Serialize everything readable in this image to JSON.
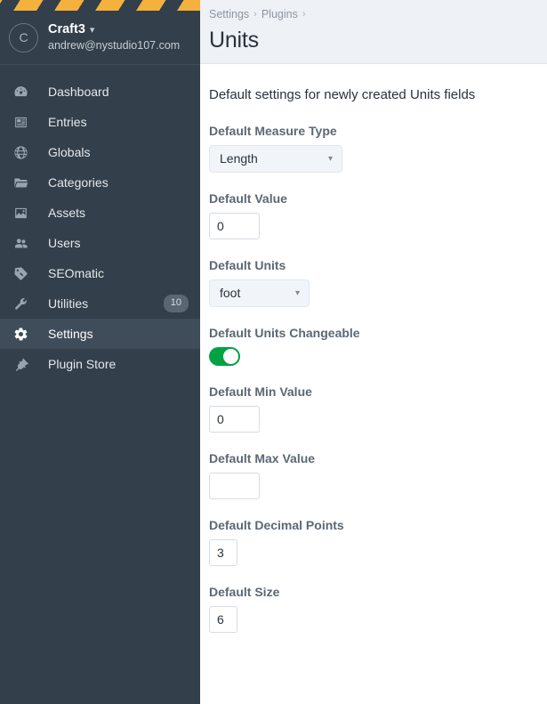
{
  "sidebar": {
    "user": {
      "avatar_initial": "C",
      "name": "Craft3",
      "caret_icon": "chevron-down-icon",
      "email": "andrew@nystudio107.com"
    },
    "items": [
      {
        "label": "Dashboard",
        "icon": "gauge-icon",
        "badge": null,
        "active": false
      },
      {
        "label": "Entries",
        "icon": "newspaper-icon",
        "badge": null,
        "active": false
      },
      {
        "label": "Globals",
        "icon": "globe-icon",
        "badge": null,
        "active": false
      },
      {
        "label": "Categories",
        "icon": "folder-icon",
        "badge": null,
        "active": false
      },
      {
        "label": "Assets",
        "icon": "image-icon",
        "badge": null,
        "active": false
      },
      {
        "label": "Users",
        "icon": "users-icon",
        "badge": null,
        "active": false
      },
      {
        "label": "SEOmatic",
        "icon": "tag-icon",
        "badge": null,
        "active": false
      },
      {
        "label": "Utilities",
        "icon": "wrench-icon",
        "badge": "10",
        "active": false
      },
      {
        "label": "Settings",
        "icon": "gear-icon",
        "badge": null,
        "active": true
      },
      {
        "label": "Plugin Store",
        "icon": "plug-icon",
        "badge": null,
        "active": false
      }
    ]
  },
  "header": {
    "breadcrumbs": [
      {
        "label": "Settings"
      },
      {
        "label": "Plugins"
      }
    ],
    "separator": "›",
    "title": "Units"
  },
  "main": {
    "intro": "Default settings for newly created Units fields",
    "fields": [
      {
        "label": "Default Measure Type",
        "type": "select",
        "value": "Length",
        "options": [
          "Length"
        ]
      },
      {
        "label": "Default Value",
        "type": "text",
        "value": "0",
        "placeholder": ""
      },
      {
        "label": "Default Units",
        "type": "select",
        "value": "foot",
        "options": [
          "foot"
        ]
      },
      {
        "label": "Default Units Changeable",
        "type": "toggle",
        "value": "on"
      },
      {
        "label": "Default Min Value",
        "type": "text",
        "value": "0",
        "placeholder": ""
      },
      {
        "label": "Default Max Value",
        "type": "text",
        "value": "",
        "placeholder": ""
      },
      {
        "label": "Default Decimal Points",
        "type": "text",
        "value": "3",
        "placeholder": ""
      },
      {
        "label": "Default Size",
        "type": "text",
        "value": "6",
        "placeholder": ""
      }
    ]
  },
  "colors": {
    "sidebar_bg": "#333f4a",
    "sidebar_active_bg": "#3f4d5a",
    "stripe_accent": "#f4b13d",
    "toggle_on": "#00a242",
    "header_bg": "#eef1f5",
    "label_text": "#5b6875"
  }
}
